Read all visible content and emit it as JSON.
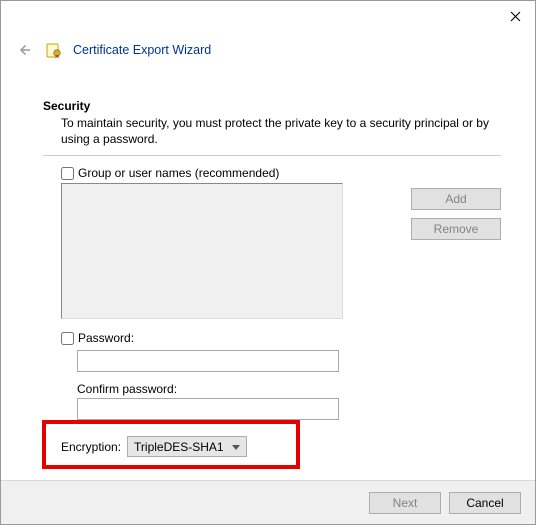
{
  "header": {
    "title": "Certificate Export Wizard"
  },
  "section": {
    "heading": "Security",
    "description": "To maintain security, you must protect the private key to a security principal or by using a password."
  },
  "group": {
    "checkbox_label": "Group or user names (recommended)",
    "checked": false,
    "add_label": "Add",
    "remove_label": "Remove"
  },
  "password": {
    "checkbox_label": "Password:",
    "checked": false,
    "value": "",
    "confirm_label": "Confirm password:",
    "confirm_value": ""
  },
  "encryption": {
    "label": "Encryption:",
    "selected": "TripleDES-SHA1"
  },
  "footer": {
    "next_label": "Next",
    "cancel_label": "Cancel"
  }
}
